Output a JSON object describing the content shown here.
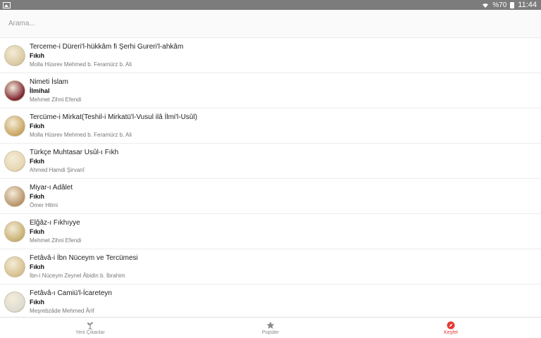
{
  "status_bar": {
    "battery": "%70",
    "time": "11:44"
  },
  "search": {
    "placeholder": "Arama..."
  },
  "books": [
    {
      "title": "Terceme-i Düreri'l-hükkâm fi Şerhi Gureri'l-ahkâm",
      "category": "Fıkıh",
      "author": "Molla Hüsrev Mehmed b. Feramürz b. Ali",
      "cover_color": "#d9c9a0"
    },
    {
      "title": "Nimeti İslam",
      "category": "İlmihal",
      "author": "Mehmet Zihni Efendi",
      "cover_color": "#7d2230"
    },
    {
      "title": "Tercüme-i Mirkat(Teshil-i Mirkatü'l-Vusul ilâ İlmi'l-Usûl)",
      "category": "Fıkıh",
      "author": "Molla Hüsrev Mehmed b. Feramürz b. Ali",
      "cover_color": "#c9a560"
    },
    {
      "title": "Türkçe Muhtasar Usûl-ı Fıkh",
      "category": "Fıkıh",
      "author": "Ahmed Hamdi Şirvanî",
      "cover_color": "#e6d6b0"
    },
    {
      "title": "Miyar-ı Adâlet",
      "category": "Fıkıh",
      "author": "Ömer Hilmi",
      "cover_color": "#b9926a"
    },
    {
      "title": "Elğâz-ı Fıkhıyye",
      "category": "Fıkıh",
      "author": "Mehmet Zihni Efendi",
      "cover_color": "#c9b070"
    },
    {
      "title": "Fetâvâ-i İbn Nüceym ve Tercümesi",
      "category": "Fıkıh",
      "author": "İbn-i Nüceym Zeynel Âbidin b. İbrahim",
      "cover_color": "#d8c08e"
    },
    {
      "title": "Fetâvâ-ı Camiü'l-İcareteyn",
      "category": "Fıkıh",
      "author": "Meşrebzâde Mehmed Ârif",
      "cover_color": "#dcdcd4"
    }
  ],
  "tabs": [
    {
      "label": "Yeni Çıkanlar",
      "icon": "sprout-icon",
      "active": false
    },
    {
      "label": "Popüler",
      "icon": "star-icon",
      "active": false
    },
    {
      "label": "Keşfet",
      "icon": "compass-icon",
      "active": true
    }
  ],
  "colors": {
    "accent": "#e53935",
    "inactive_tab": "#8a8a8a",
    "status_bar": "#7c7c7c"
  }
}
